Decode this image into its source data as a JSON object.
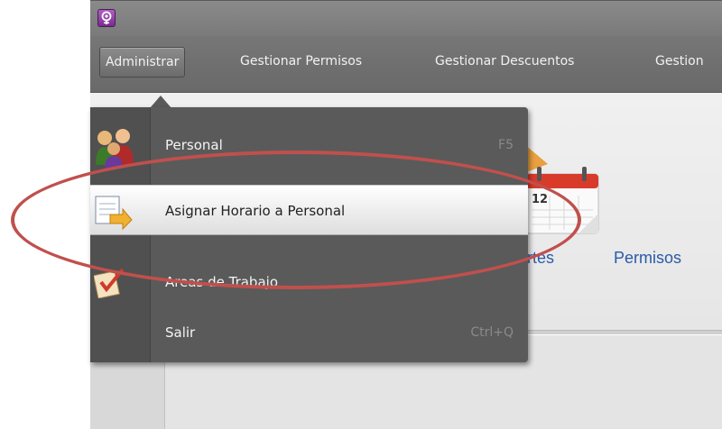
{
  "menubar": {
    "items": [
      {
        "label": "Administrar"
      },
      {
        "label": "Gestionar Permisos"
      },
      {
        "label": "Gestionar Descuentos"
      },
      {
        "label": "Gestion"
      }
    ]
  },
  "ribbon": {
    "permisos_label": "Permisos",
    "partial_label": "rtes"
  },
  "dropdown": {
    "items": [
      {
        "label": "Personal",
        "shortcut": "F5"
      },
      {
        "label": "Asignar Horario a Personal",
        "shortcut": ""
      },
      {
        "label": "Areas de Trabajo",
        "shortcut": ""
      },
      {
        "label": "Salir",
        "shortcut": "Ctrl+Q"
      }
    ]
  },
  "calendar_icon": {
    "day": "12"
  },
  "colors": {
    "annotation": "#c0504d",
    "link_text": "#2a5aa8",
    "menu_bg": "#5a5a5a"
  }
}
